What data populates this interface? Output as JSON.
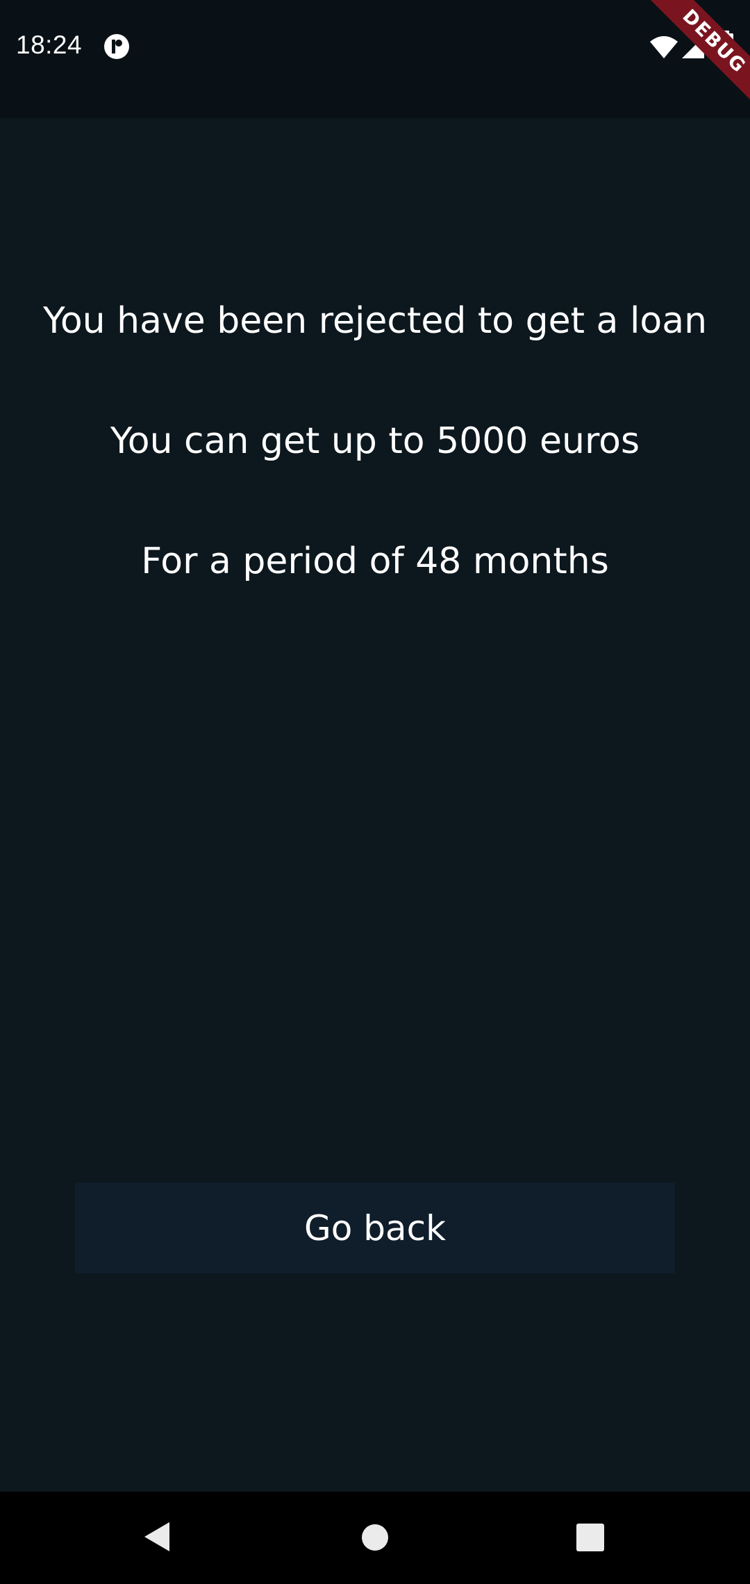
{
  "status_bar": {
    "time": "18:24",
    "icons": [
      "notification-icon",
      "wifi-icon",
      "cell-signal-icon",
      "battery-icon"
    ]
  },
  "debug_banner": {
    "label": "DEBUG",
    "color": "#7a1520"
  },
  "content": {
    "line_1": "You have been rejected to get a loan",
    "line_2": "You can get up to 5000 euros",
    "line_3": "For a period of 48 months"
  },
  "actions": {
    "go_back_label": "Go back"
  },
  "nav_bar": {
    "icons": [
      "back-icon",
      "home-icon",
      "recents-icon"
    ]
  },
  "colors": {
    "background": "#0c171e",
    "status_bar": "#091116",
    "button": "#101e2b",
    "text": "#ffffff"
  }
}
